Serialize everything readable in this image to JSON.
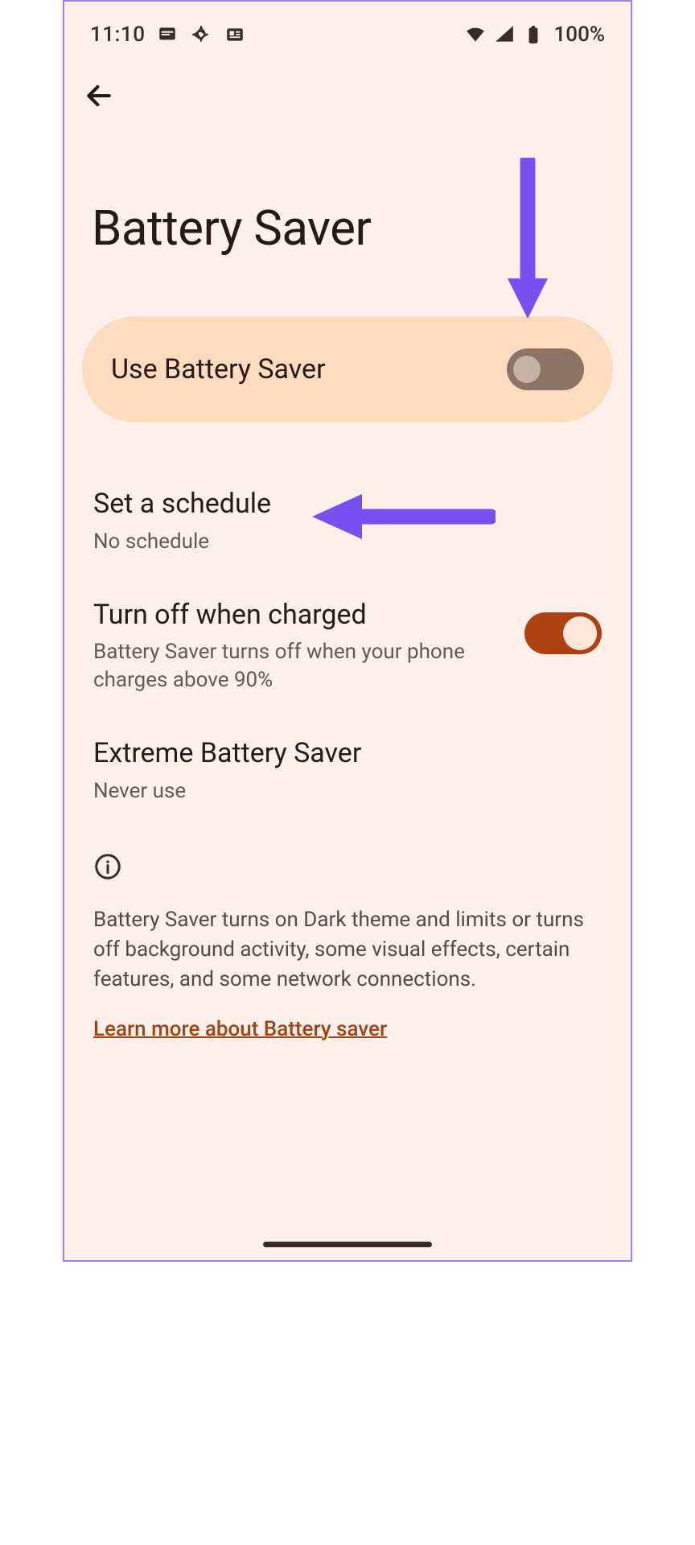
{
  "status": {
    "time": "11:10",
    "battery_text": "100%"
  },
  "header": {
    "title": "Battery Saver"
  },
  "pill": {
    "label": "Use Battery Saver",
    "enabled": false
  },
  "settings": {
    "schedule": {
      "title": "Set a schedule",
      "subtitle": "No schedule"
    },
    "turn_off": {
      "title": "Turn off when charged",
      "subtitle": "Battery Saver turns off when your phone charges above 90%",
      "enabled": true
    },
    "extreme": {
      "title": "Extreme Battery Saver",
      "subtitle": "Never use"
    }
  },
  "info": {
    "text": "Battery Saver turns on Dark theme and limits or turns off background activity, some visual effects, certain features, and some network connections.",
    "link_label": "Learn more about Battery saver"
  },
  "annotations": {
    "arrow_color": "#7a4ff0"
  }
}
